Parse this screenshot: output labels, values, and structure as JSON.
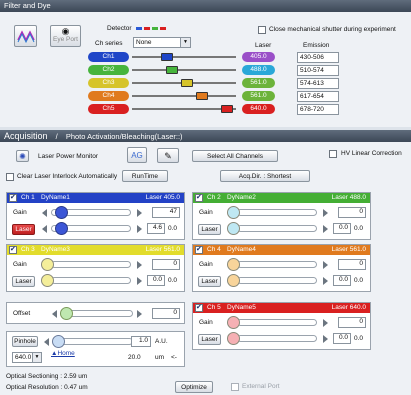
{
  "filter_dye": {
    "title": "Filter and Dye",
    "eyeport_label": "Eye Port",
    "detector_label": "Detector",
    "ch_series_label": "Ch series",
    "ch_series_value": "None",
    "laser_header": "Laser",
    "emission_header": "Emission",
    "shutter_label": "Close mechanical shutter during experiment",
    "channels": [
      {
        "name": "Ch1",
        "color": "#1f46c8",
        "slider": 0.35,
        "laser": "405.0",
        "laser_color": "#9a4fc8",
        "emission": "430-506"
      },
      {
        "name": "Ch2",
        "color": "#46b43c",
        "slider": 0.4,
        "laser": "488.0",
        "laser_color": "#2aa8d8",
        "emission": "510-574"
      },
      {
        "name": "Ch3",
        "color": "#d6c42a",
        "slider": 0.55,
        "laser": "561.0",
        "laser_color": "#6cb33a",
        "emission": "574-613"
      },
      {
        "name": "Ch4",
        "color": "#e07a1e",
        "slider": 0.7,
        "laser": "561.0",
        "laser_color": "#6cb33a",
        "emission": "617-654"
      },
      {
        "name": "Ch5",
        "color": "#d92020",
        "slider": 0.95,
        "laser": "640.0",
        "laser_color": "#d92020",
        "emission": "678-720"
      }
    ]
  },
  "acquisition": {
    "tab_acq": "Acquisition",
    "tab_sep": "/",
    "tab_photo": "Photo Activation/Bleaching(Laser::)",
    "laser_power_monitor": "Laser Power Monitor",
    "select_all_channels": "Select All Channels",
    "hv_linear": "HV Linear Correction",
    "clear_laser": "Clear Laser Interlock Automatically",
    "runtime": "RunTime",
    "acq_dir": "Acq.Dir. : Shortest"
  },
  "channels": [
    {
      "check": true,
      "ch": "Ch 1",
      "dye": "DyName1",
      "laser": "Laser 405.0",
      "hdr_color": "#2342c6",
      "knob_color": "#3c56d6",
      "gain_label": "Gain",
      "gain_value": "47",
      "laser_btn": "Laser",
      "laser_value": "4.6",
      "laser_extra": "0.0",
      "laser_red": true
    },
    {
      "check": true,
      "ch": "Ch 2",
      "dye": "DyName2",
      "laser": "Laser 488.0",
      "hdr_color": "#44ae34",
      "knob_color": "#bfe8f3",
      "gain_label": "Gain",
      "gain_value": "0",
      "laser_btn": "Laser",
      "laser_value": "0.0",
      "laser_extra": "0.0",
      "laser_red": false
    },
    {
      "check": true,
      "ch": "Ch 3",
      "dye": "DyName3",
      "laser": "Laser 561.0",
      "hdr_color": "#e2dc2c",
      "knob_color": "#f4ee9a",
      "gain_label": "Gain",
      "gain_value": "0",
      "laser_btn": "Laser",
      "laser_value": "0.0",
      "laser_extra": "0.0",
      "laser_red": false
    },
    {
      "check": true,
      "ch": "Ch 4",
      "dye": "DyName4",
      "laser": "Laser 561.0",
      "hdr_color": "#e07a1e",
      "knob_color": "#f8d49a",
      "gain_label": "Gain",
      "gain_value": "0",
      "laser_btn": "Laser",
      "laser_value": "0.0",
      "laser_extra": "0.0",
      "laser_red": false
    },
    {
      "check": true,
      "ch": "Ch 5",
      "dye": "DyName5",
      "laser": "Laser 640.0",
      "hdr_color": "#d92020",
      "knob_color": "#f6b0b4",
      "gain_label": "Gain",
      "gain_value": "0",
      "laser_btn": "Laser",
      "laser_value": "0.0",
      "laser_extra": "0.0",
      "laser_red": false
    }
  ],
  "offset": {
    "label": "Offset",
    "value": "0"
  },
  "pinhole": {
    "button": "Pinhole",
    "select": "640.0",
    "home": "Home",
    "value": "1.0",
    "unit1": "A.U.",
    "um_value": "20.0",
    "um_unit": "um",
    "arrow": "<-"
  },
  "footer": {
    "optical_sectioning": "Optical Sectioning : 2.59 um",
    "optical_resolution": "Optical Resolution : 0.47 um",
    "optimize": "Optimize",
    "external_port": "External Port"
  }
}
